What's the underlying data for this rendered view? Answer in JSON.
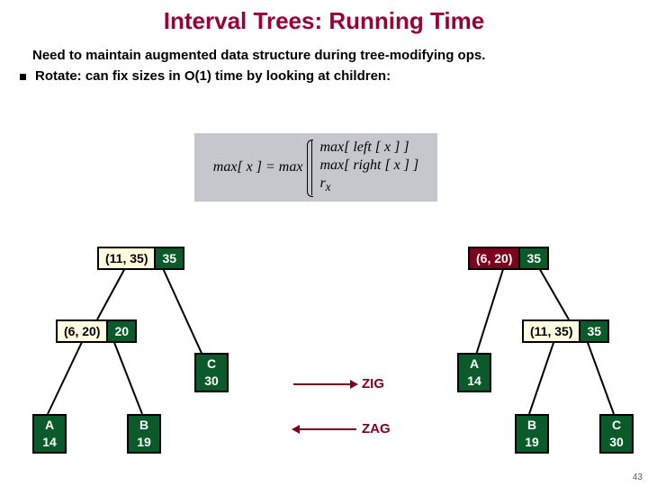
{
  "title": "Interval Trees:  Running Time",
  "intro": "Need to maintain augmented data structure during tree-modifying ops.",
  "bullet": "Rotate:  can fix sizes in O(1) time by looking at children:",
  "formula": {
    "lhs": "max[ x ] = max",
    "case1": "max[ left [ x ] ]",
    "case2": "max[ right [ x ] ]",
    "case3": "r",
    "case3sub": "x"
  },
  "left_tree": {
    "root": {
      "interval": "(11, 35)",
      "max": "35"
    },
    "left": {
      "interval": "(6, 20)",
      "max": "20"
    },
    "leafA": {
      "label": "A",
      "val": "14"
    },
    "leafB": {
      "label": "B",
      "val": "19"
    },
    "leafC": {
      "label": "C",
      "val": "30"
    }
  },
  "right_tree": {
    "root": {
      "interval": "(6, 20)",
      "max": "35"
    },
    "right": {
      "interval": "(11, 35)",
      "max": "35"
    },
    "leafA": {
      "label": "A",
      "val": "14"
    },
    "leafB": {
      "label": "B",
      "val": "19"
    },
    "leafC": {
      "label": "C",
      "val": "30"
    }
  },
  "arrows": {
    "zig": "ZIG",
    "zag": "ZAG"
  },
  "page": "43"
}
